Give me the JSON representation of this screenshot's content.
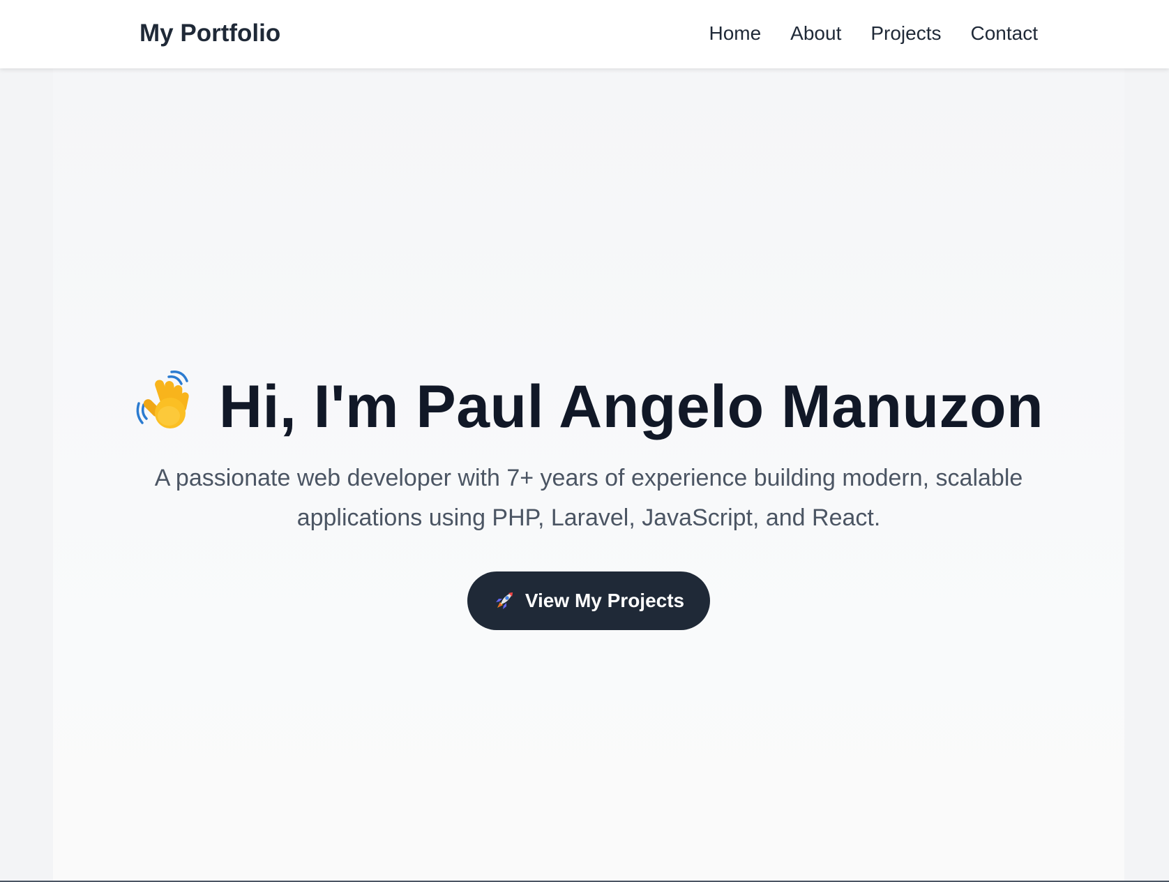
{
  "header": {
    "brand": "My Portfolio",
    "nav": [
      {
        "label": "Home"
      },
      {
        "label": "About"
      },
      {
        "label": "Projects"
      },
      {
        "label": "Contact"
      }
    ]
  },
  "hero": {
    "title": "Hi, I'm Paul Angelo Manuzon",
    "title_icon": "waving-hand-icon",
    "subtitle": "A passionate web developer with 7+ years of experience building modern, scalable applications using PHP, Laravel, JavaScript, and React.",
    "cta": {
      "label": "View My Projects",
      "icon": "rocket-icon"
    }
  },
  "colors": {
    "navbar_bg": "#ffffff",
    "page_bg": "#f3f4f6",
    "text_dark": "#111827",
    "text_muted": "#4b5563",
    "button_bg": "#1f2937",
    "button_text": "#ffffff"
  }
}
